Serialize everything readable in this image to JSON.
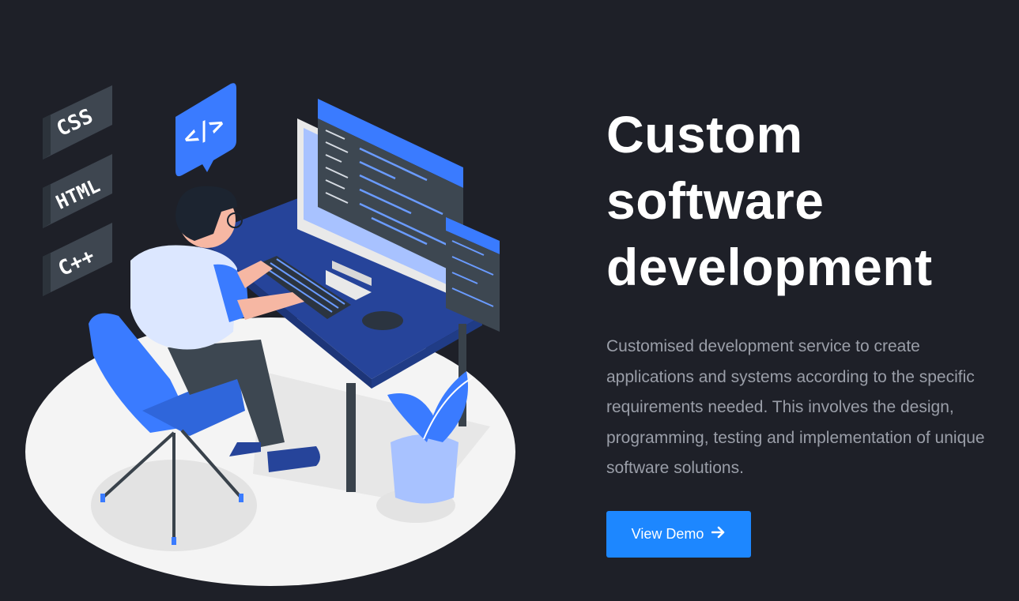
{
  "hero": {
    "title_lines": [
      "Custom",
      "software",
      "development"
    ],
    "description": "Customised development service to create applications and systems according to the specific requirements needed. This involves the design, programming, testing and implementation of unique software solutions.",
    "cta_label": "View Demo",
    "cta_icon": "arrow-right-icon"
  },
  "illustration": {
    "tags": [
      "CSS",
      "HTML",
      "C++"
    ],
    "bubble_text": "</>"
  },
  "colors": {
    "background": "#1e2028",
    "accent": "#1d87ff",
    "illustration_blue": "#3a7bff",
    "desk_blue": "#26449a"
  }
}
